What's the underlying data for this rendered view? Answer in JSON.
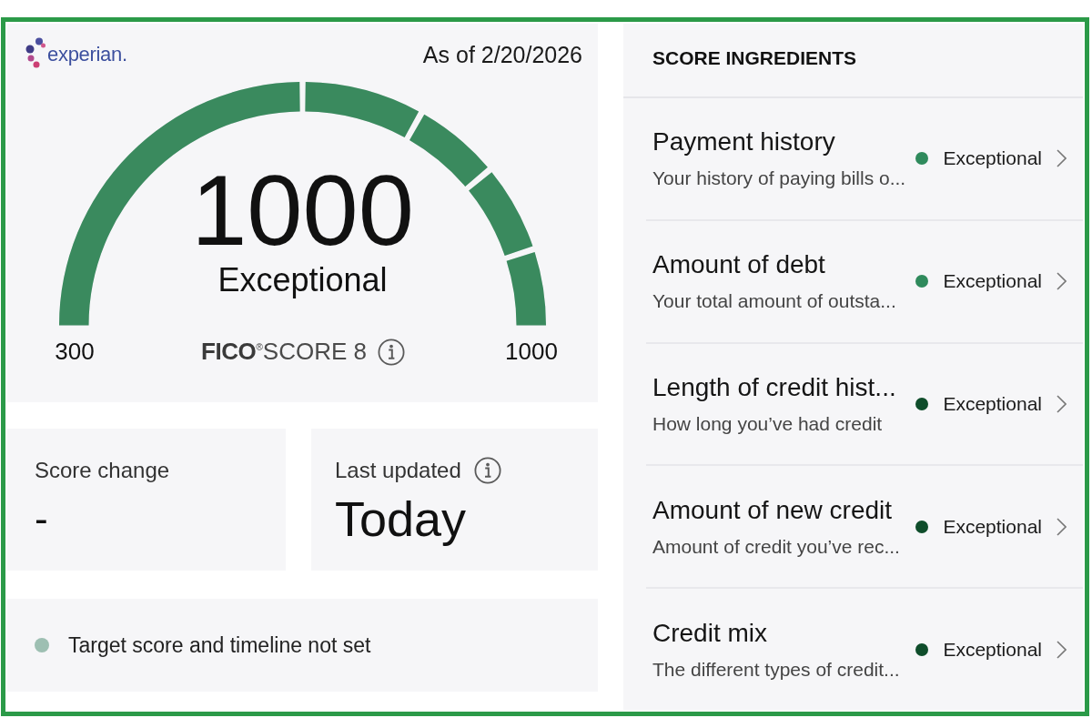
{
  "score_card": {
    "logo": "experian.",
    "as_of": "As of 2/20/2026",
    "gauge": {
      "level": 1
    },
    "score": "1000",
    "rating": "Exceptional",
    "range_min": "300",
    "range_max": "1000",
    "model": "**FICO**$^{®}$SCORE 8"
  },
  "score_change": {
    "label": "Score change",
    "value": "-"
  },
  "last_updated": {
    "label": "Last updated",
    "value": "Today"
  },
  "target": {
    "text": "Target score and timeline not set"
  },
  "ingredients": {
    "heading": "SCORE INGREDIENTS",
    "items": [
      {
        "title": "Payment history",
        "description": "Your history of paying bills o...",
        "rating": "Exceptional",
        "color": "#2f8a5c"
      },
      {
        "title": "Amount of debt",
        "description": "Your total amount of outsta...",
        "rating": "Exceptional",
        "color": "#2f8a5c"
      },
      {
        "title": "Length of credit hist...",
        "description": "How long you’ve had credit",
        "rating": "Exceptional",
        "color": "#0f4d2b"
      },
      {
        "title": "Amount of new credit",
        "description": "Amount of credit you’ve rec...",
        "rating": "Exceptional",
        "color": "#0f4d2b"
      },
      {
        "title": "Credit mix",
        "description": "The different types of credit...",
        "rating": "Exceptional",
        "color": "#0f4d2b"
      }
    ]
  }
}
